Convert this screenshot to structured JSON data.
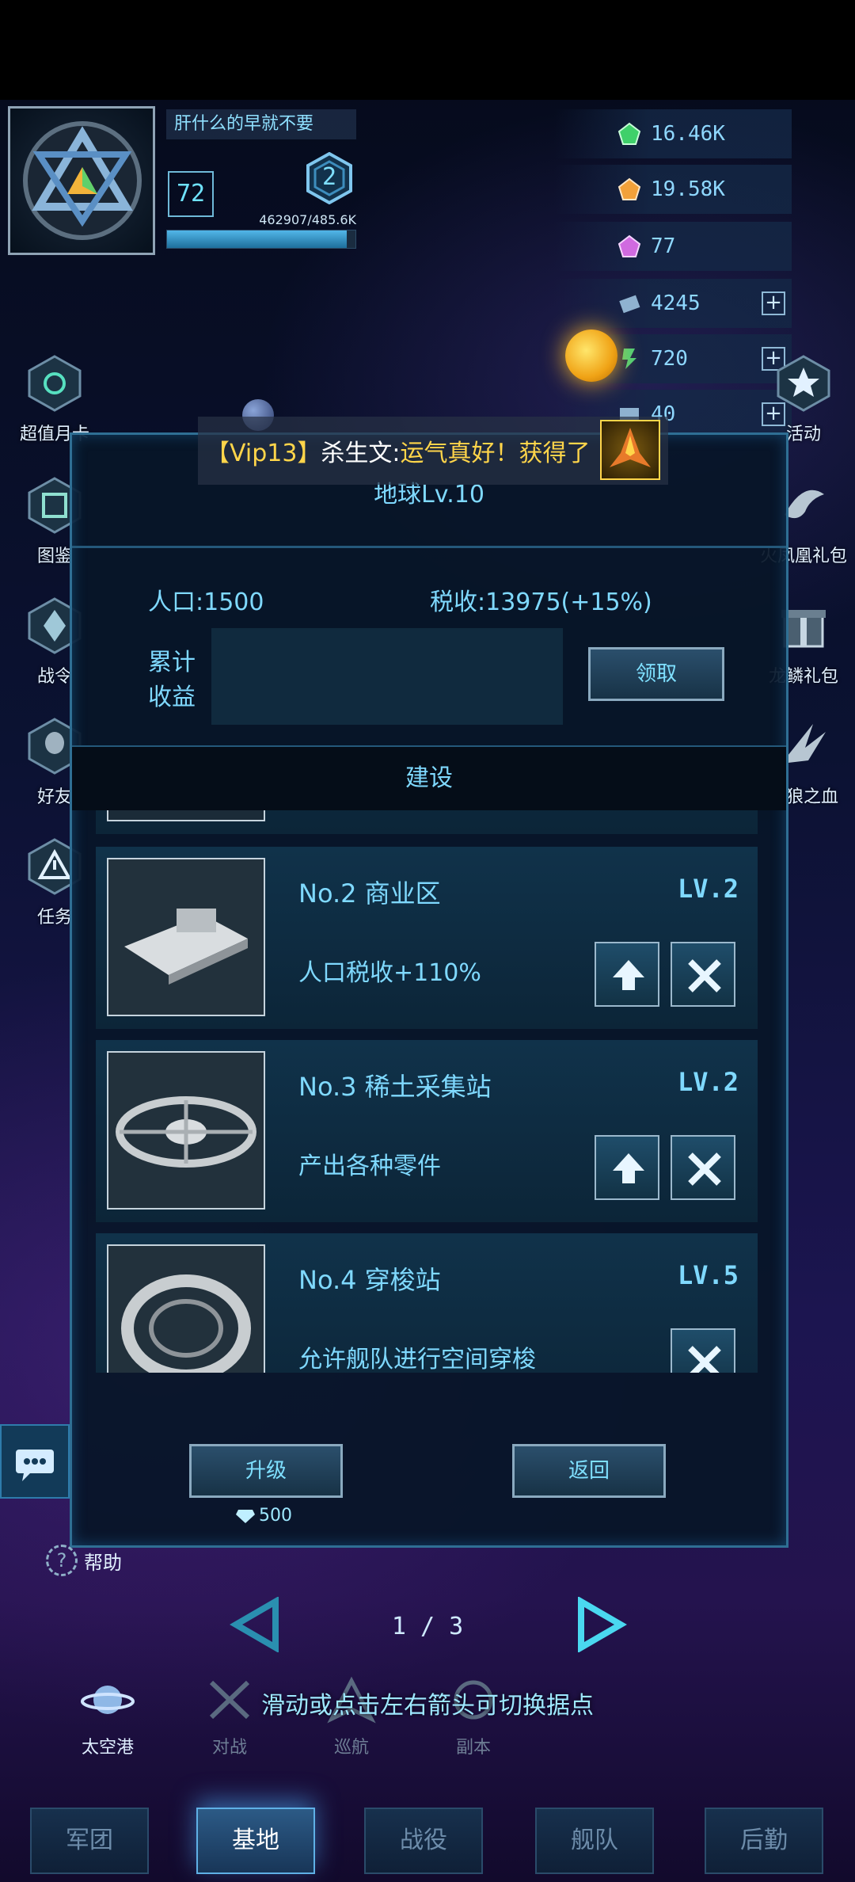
{
  "player": {
    "name": "肝什么的早就不要",
    "level": "72",
    "rank": "2",
    "exp_text": "462907/485.6K",
    "exp_fraction": 0.953
  },
  "resources": [
    {
      "icon": "green-gem-icon",
      "value": "16.46K",
      "color": "#3fd06a"
    },
    {
      "icon": "orange-gem-icon",
      "value": "19.58K",
      "color": "#f2a13a"
    },
    {
      "icon": "purple-gem-icon",
      "value": "77",
      "color": "#d06ae0"
    },
    {
      "icon": "crystal-icon",
      "value": "4245",
      "plus": "+",
      "color": "#8fb2d0"
    },
    {
      "icon": "energy-icon",
      "value": "720",
      "plus": "+",
      "color": "#4ccf78"
    },
    {
      "icon": "ticket-icon",
      "value": "40",
      "plus": "+",
      "color": "#8fb2d0"
    }
  ],
  "left_menu": [
    "超值月卡",
    "图鉴",
    "战令",
    "好友",
    "任务"
  ],
  "right_menu": [
    "活动",
    "火凤凰礼包",
    "龙鳞礼包",
    "狂狼之血"
  ],
  "marquee": {
    "vip": "【Vip13】",
    "name": "杀生文:",
    "message": "运气真好！获得了"
  },
  "dialog": {
    "title": "地球Lv.10",
    "population": "人口:1500",
    "tax": "税收:13975(+15%)",
    "income_label": "累计收益",
    "claim": "领取",
    "build_header": "建设",
    "buildings": [
      {
        "no": "No.2",
        "name": "商业区",
        "level": "LV.2",
        "desc": "人口税收+110%",
        "upgradable": true
      },
      {
        "no": "No.3",
        "name": "稀土采集站",
        "level": "LV.2",
        "desc": "产出各种零件",
        "upgradable": true
      },
      {
        "no": "No.4",
        "name": "穿梭站",
        "level": "LV.5",
        "desc": "允许舰队进行空间穿梭",
        "upgradable": false
      }
    ],
    "upgrade": "升级",
    "back": "返回",
    "cost": "500"
  },
  "help": "帮助",
  "pager": {
    "text": "1 / 3"
  },
  "hint": "滑动或点击左右箭头可切换据点",
  "modes": [
    "太空港",
    "对战",
    "巡航",
    "副本"
  ],
  "tabs": [
    "军团",
    "基地",
    "战役",
    "舰队",
    "后勤"
  ],
  "active_tab": "基地"
}
